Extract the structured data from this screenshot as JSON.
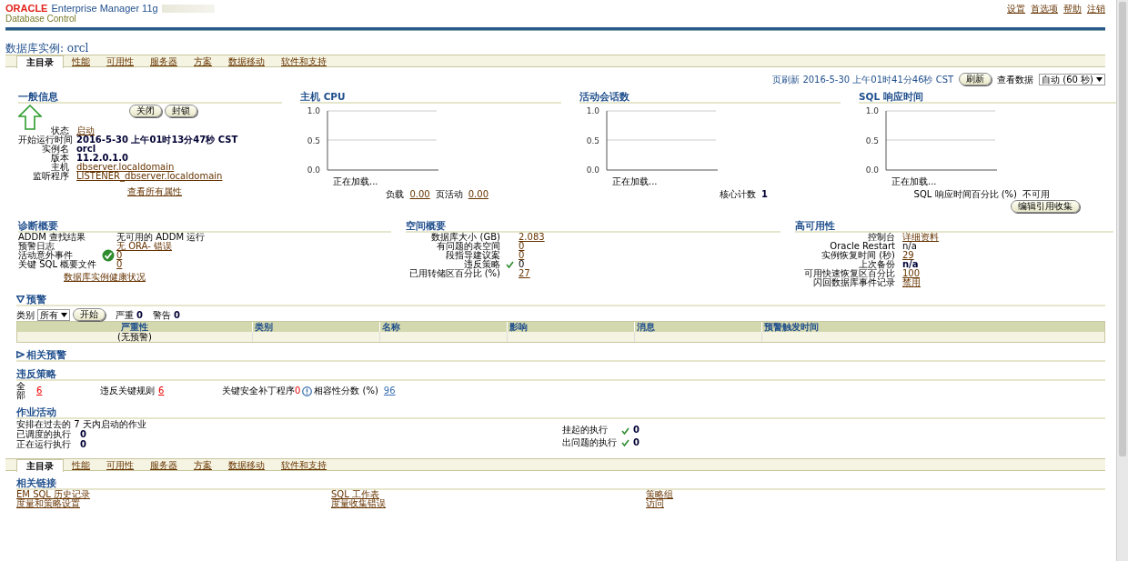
{
  "header": {
    "logo": "ORACLE",
    "product": "Enterprise Manager 11g",
    "subtitle": "Database Control",
    "global_links": [
      "设置",
      "首选项",
      "帮助",
      "注销"
    ]
  },
  "page_title": "数据库实例: orcl",
  "tabs": [
    {
      "label": "主目录",
      "selected": true
    },
    {
      "label": "性能",
      "selected": false
    },
    {
      "label": "可用性",
      "selected": false
    },
    {
      "label": "服务器",
      "selected": false
    },
    {
      "label": "方案",
      "selected": false
    },
    {
      "label": "数据移动",
      "selected": false
    },
    {
      "label": "软件和支持",
      "selected": false
    }
  ],
  "refresh": {
    "label": "页刷新 2016-5-30 上午01时41分46秒 CST",
    "button": "刷新",
    "view_label": "查看数据",
    "view_value": "自动 (60 秒)"
  },
  "general": {
    "title": "一般信息",
    "buttons": [
      "关闭",
      "封锁"
    ],
    "fields": [
      {
        "label": "状态",
        "value": "启动",
        "kind": "link"
      },
      {
        "label": "开始运行时间",
        "value": "2016-5-30 上午01时13分47秒 CST",
        "kind": "bold"
      },
      {
        "label": "实例名",
        "value": "orcl",
        "kind": "bold"
      },
      {
        "label": "版本",
        "value": "11.2.0.1.0",
        "kind": "bold"
      },
      {
        "label": "主机",
        "value": "dbserver.localdomain",
        "kind": "link"
      },
      {
        "label": "监听程序",
        "value": "LISTENER_dbserver.localdomain",
        "kind": "link"
      }
    ],
    "link": "查看所有属性"
  },
  "charts": [
    {
      "title": "主机 CPU",
      "ticks": [
        "1.0",
        "0.5",
        "0.0"
      ],
      "status": "正在加载...",
      "footer": [
        {
          "label": "负载",
          "value": "0.00",
          "kind": "link"
        },
        {
          "label": "页活动",
          "value": "0.00",
          "kind": "link"
        }
      ]
    },
    {
      "title": "活动会话数",
      "ticks": [
        "1.0",
        "0.5",
        "0.0"
      ],
      "status": "正在加载...",
      "footer": [
        {
          "label": "核心计数",
          "value": "1",
          "kind": "bold"
        }
      ]
    },
    {
      "title": "SQL 响应时间",
      "ticks": [
        "1.0",
        "0.5",
        "0.0"
      ],
      "status": "正在加载...",
      "footer": [
        {
          "label": "SQL 响应时间百分比 (%)",
          "value": "不可用",
          "kind": "plain"
        }
      ],
      "button": "编辑引用收集"
    }
  ],
  "diagnostics": {
    "title": "诊断概要",
    "fields": [
      {
        "label": "ADDM 查找结果",
        "value": "无可用的 ADDM 运行",
        "kind": "plain"
      },
      {
        "label": "预警日志",
        "value": "无 ORA- 错误",
        "kind": "link"
      },
      {
        "label": "活动意外事件",
        "value": "0",
        "kind": "link",
        "ok": true
      },
      {
        "label": "关键 SQL 概要文件",
        "value": "0",
        "kind": "link"
      }
    ],
    "link": "数据库实例健康状况"
  },
  "space": {
    "title": "空间概要",
    "fields": [
      {
        "label": "数据库大小 (GB)",
        "value": "2.083",
        "kind": "link"
      },
      {
        "label": "有问题的表空间",
        "value": "0",
        "kind": "link"
      },
      {
        "label": "段指导建议案",
        "value": "0",
        "kind": "link"
      },
      {
        "label": "违反策略",
        "value": "0",
        "kind": "plain",
        "ok": true
      },
      {
        "label": "已用转储区百分比 (%)",
        "value": "27",
        "kind": "link"
      }
    ]
  },
  "availability": {
    "title": "高可用性",
    "fields": [
      {
        "label": "控制台",
        "value": "详细资料",
        "kind": "link"
      },
      {
        "label": "Oracle Restart",
        "value": "n/a",
        "kind": "plain"
      },
      {
        "label": "实例恢复时间 (秒)",
        "value": "29",
        "kind": "link"
      },
      {
        "label": "上次备份",
        "value": "n/a",
        "kind": "bold"
      },
      {
        "label": "可用快速恢复区百分比",
        "value": "100",
        "kind": "link"
      },
      {
        "label": "闪回数据库事件记录",
        "value": "禁用",
        "kind": "link"
      }
    ]
  },
  "alerts": {
    "title": "预警",
    "expanded": true,
    "filter_label": "类别",
    "filter_value": "所有",
    "button": "开始",
    "counts": [
      {
        "label": "严重",
        "value": "0"
      },
      {
        "label": "警告",
        "value": "0"
      }
    ],
    "columns": [
      "严重性",
      "类别",
      "名称",
      "影响",
      "消息",
      "预警触发时间"
    ],
    "empty_message": "(无预警)"
  },
  "related_alerts": {
    "title": "相关预警",
    "expanded": false
  },
  "policy": {
    "title": "违反策略",
    "items": [
      {
        "label": "全部",
        "value": "6"
      },
      {
        "label": "违反关键规则",
        "value": "6"
      }
    ],
    "patch_label": "关键安全补丁程序",
    "patch_value": "0",
    "score_label": "相容性分数 (%)",
    "score_value": "96"
  },
  "jobs": {
    "title": "作业活动",
    "caption": "安排在过去的 7 天内启动的作业",
    "left": [
      {
        "label": "已调度的执行",
        "value": "0"
      },
      {
        "label": "正在运行执行",
        "value": "0"
      }
    ],
    "right": [
      {
        "label": "挂起的执行",
        "value": "0",
        "ok": true
      },
      {
        "label": "出问题的执行",
        "value": "0",
        "ok": true
      }
    ]
  },
  "bottom_tabs": [
    {
      "label": "主目录",
      "selected": true
    },
    {
      "label": "性能",
      "selected": false
    },
    {
      "label": "可用性",
      "selected": false
    },
    {
      "label": "服务器",
      "selected": false
    },
    {
      "label": "方案",
      "selected": false
    },
    {
      "label": "数据移动",
      "selected": false
    },
    {
      "label": "软件和支持",
      "selected": false
    }
  ],
  "related_links": {
    "title": "相关链接",
    "columns": [
      [
        "EM SQL 历史记录",
        "度量和策略设置"
      ],
      [
        "SQL 工作表",
        "度量收集错误"
      ],
      [
        "策略组",
        "访问"
      ]
    ]
  }
}
